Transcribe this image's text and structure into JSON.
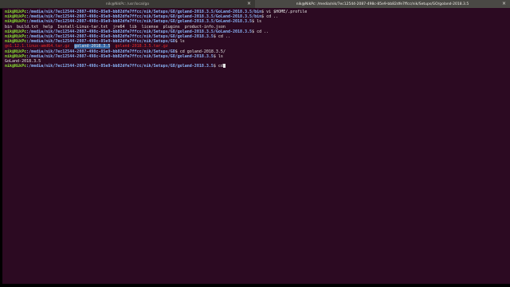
{
  "tabs": [
    {
      "title": "nik@NikPc: /usr/local/go",
      "active": false
    },
    {
      "title": "nik@NikPc: /media/nik/7ec12544-2087-498c-85e9-bb82dfe7ffcc/nik/Setups/GO/goland-2018.3.5",
      "active": true
    }
  ],
  "terminal": {
    "lines": [
      {
        "user": "nik@NikPc",
        "path": ":/media/nik/7ec12544-2087-498c-85e9-bb82dfe7ffcc/nik/Setups/GO/goland-2018.3.5/GoLand-2018.3.5/bin",
        "cmd": "$ vi $HOME/.profile"
      },
      {
        "user": "nik@NikPc",
        "path": ":/media/nik/7ec12544-2087-498c-85e9-bb82dfe7ffcc/nik/Setups/GO/goland-2018.3.5/GoLand-2018.3.5/bin",
        "cmd": "$ cd .."
      },
      {
        "user": "nik@NikPc",
        "path": ":/media/nik/7ec12544-2087-498c-85e9-bb82dfe7ffcc/nik/Setups/GO/goland-2018.3.5/GoLand-2018.3.5",
        "cmd": "$ ls"
      },
      {
        "output": "bin  build.txt  help  Install-Linux-tar.txt  jre64  lib  license  plugins  product-info.json"
      },
      {
        "user": "nik@NikPc",
        "path": ":/media/nik/7ec12544-2087-498c-85e9-bb82dfe7ffcc/nik/Setups/GO/goland-2018.3.5/GoLand-2018.3.5",
        "cmd": "$ cd .."
      },
      {
        "user": "nik@NikPc",
        "path": ":/media/nik/7ec12544-2087-498c-85e9-bb82dfe7ffcc/nik/Setups/GO/goland-2018.3.5",
        "cmd": "$ cd .."
      },
      {
        "user": "nik@NikPc",
        "path": ":/media/nik/7ec12544-2087-498c-85e9-bb82dfe7ffcc/nik/Setups/GO",
        "cmd": "$ ls"
      },
      {
        "listing": [
          "go1.12.1.linux-amd64.tar.gz",
          "goland-2018.3.5",
          "goland-2018.3.5.tar.gz"
        ]
      },
      {
        "user": "nik@NikPc",
        "path": ":/media/nik/7ec12544-2087-498c-85e9-bb82dfe7ffcc/nik/Setups/GO",
        "cmd": "$ cd goland-2018.3.5/"
      },
      {
        "user": "nik@NikPc",
        "path": ":/media/nik/7ec12544-2087-498c-85e9-bb82dfe7ffcc/nik/Setups/GO/goland-2018.3.5",
        "cmd": "$ ls"
      },
      {
        "output": "GoLand-2018.3.5"
      },
      {
        "user": "nik@NikPc",
        "path": ":/media/nik/7ec12544-2087-498c-85e9-bb82dfe7ffcc/nik/Setups/GO/goland-2018.3.5",
        "cmd": "$ cd",
        "cursor": true
      }
    ]
  }
}
